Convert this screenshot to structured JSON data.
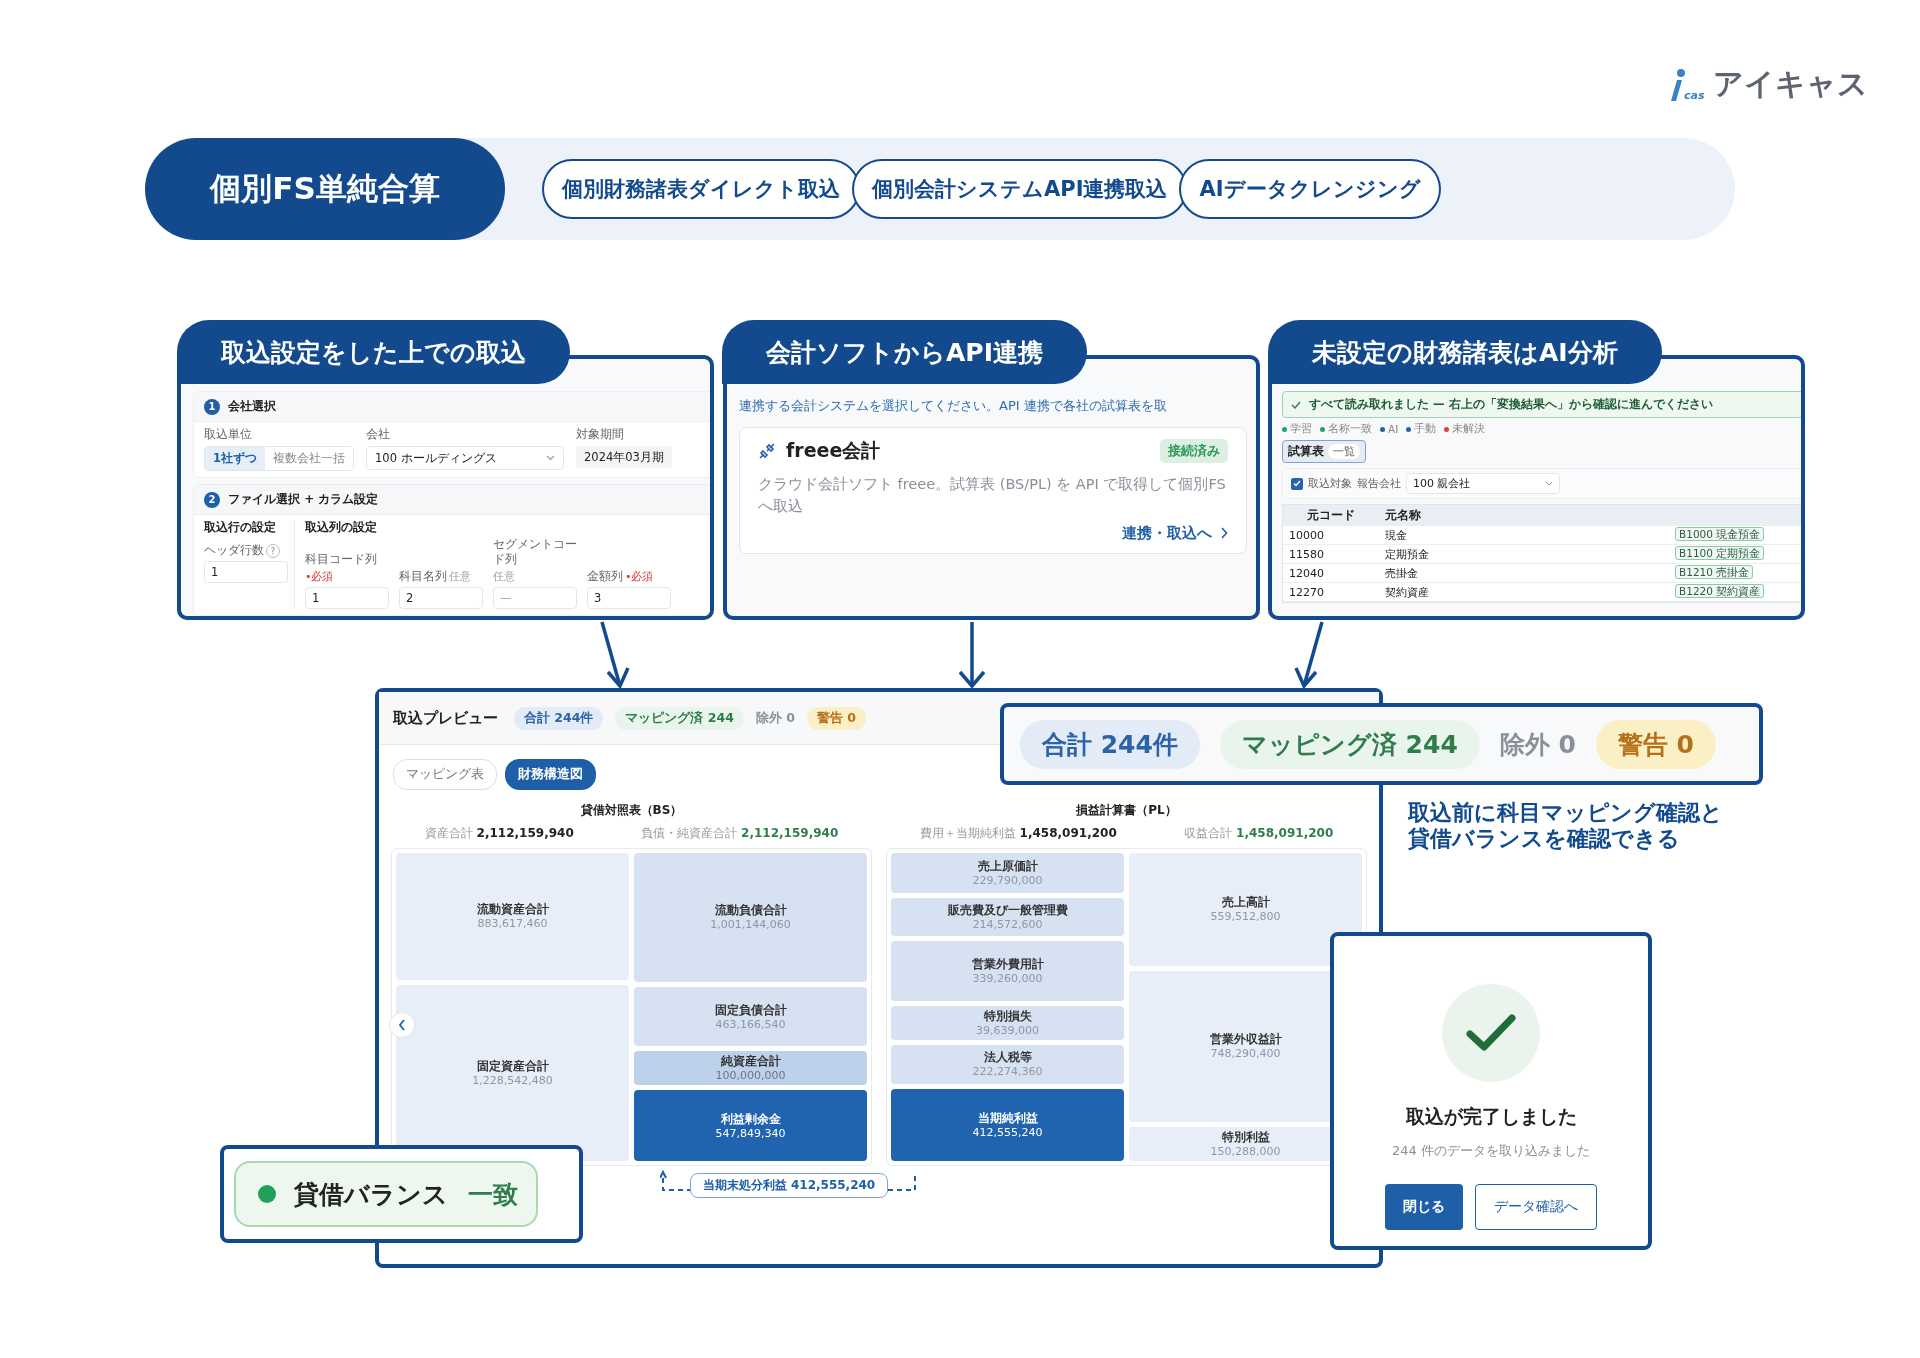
{
  "logo": {
    "mark": "cas",
    "name": "アイキャス"
  },
  "header": {
    "title": "個別FS単純合算",
    "features": [
      "個別財務諸表ダイレクト取込",
      "個別会計システムAPI連携取込",
      "AIデータクレンジング"
    ]
  },
  "import_settings_panel": {
    "title": "取込設定をした上での取込",
    "company_section": {
      "step": "1",
      "title": "会社選択",
      "unit_label": "取込単位",
      "unit_options": [
        {
          "label": "1社ずつ",
          "selected": true
        },
        {
          "label": "複数会社一括",
          "selected": false
        }
      ],
      "company_label": "会社",
      "company_value": "100 ホールディングス",
      "period_label": "対象期間",
      "period_value": "2024年03月期"
    },
    "file_section": {
      "step": "2",
      "title": "ファイル選択 + カラム設定",
      "row_settings_title": "取込行の設定",
      "header_rows_label": "ヘッダ行数",
      "help": "?",
      "header_rows_value": "1",
      "column_settings_title": "取込列の設定",
      "columns": [
        {
          "label": "科目コード列",
          "tag": "•必須",
          "required": true,
          "value": "1"
        },
        {
          "label": "科目名列",
          "tag": "任意",
          "required": false,
          "value": "2"
        },
        {
          "label": "セグメントコード列",
          "tag": "任意",
          "required": false,
          "placeholder": "—"
        },
        {
          "label": "金額列",
          "tag": "•必須",
          "required": true,
          "value": "3"
        }
      ]
    }
  },
  "api_panel": {
    "title": "会計ソフトからAPI連携",
    "description": "連携する会計システムを選択してください。API 連携で各社の試算表を取",
    "card": {
      "name": "freee会計",
      "status": "接続済み",
      "connected": true,
      "description": "クラウド会計ソフト freee。試算表 (BS/PL) を API で取得して個別FSへ取込",
      "action": "連携・取込へ"
    }
  },
  "ai_panel": {
    "title": "未設定の財務諸表はAI分析",
    "banner": "すべて読み取れました — 右上の「変換結果へ」から確認に進んでください",
    "legend": [
      {
        "label": "学習",
        "color": "#22a06b"
      },
      {
        "label": "名称一致",
        "color": "#22a06b"
      },
      {
        "label": "AI",
        "color": "#2563b0"
      },
      {
        "label": "手動",
        "color": "#2563b0"
      },
      {
        "label": "未解決",
        "color": "#e03e3e"
      }
    ],
    "tab": {
      "label": "試算表",
      "chip": "一覧"
    },
    "filter": {
      "checkbox_label": "取込対象",
      "checked": true,
      "company_label": "報告会社",
      "company_value": "100 親会社"
    },
    "table": {
      "columns": [
        "元コード",
        "元名称"
      ],
      "rows": [
        {
          "code": "10000",
          "name": "現金",
          "mapped": "B1000 現金預金"
        },
        {
          "code": "11580",
          "name": "定期預金",
          "mapped": "B1100 定期預金"
        },
        {
          "code": "12040",
          "name": "売掛金",
          "mapped": "B1210 売掛金"
        },
        {
          "code": "12270",
          "name": "契約資産",
          "mapped": "B1220 契約資産"
        }
      ]
    }
  },
  "preview": {
    "title": "取込プレビュー",
    "stats": [
      {
        "kind": "total",
        "label": "合計 244件"
      },
      {
        "kind": "mapped",
        "label": "マッピング済 244"
      },
      {
        "kind": "excluded",
        "label": "除外 0"
      },
      {
        "kind": "warning",
        "label": "警告 0"
      }
    ],
    "tabs": [
      {
        "label": "マッピング表",
        "selected": false
      },
      {
        "label": "財務構造図",
        "selected": true
      }
    ],
    "statements": [
      {
        "title": "貸借対照表（BS）",
        "left_total": {
          "label": "資産合計",
          "value": "2,112,159,940"
        },
        "right_total": {
          "label": "負債・純資産合計",
          "value": "2,112,159,940"
        },
        "left": [
          {
            "name": "流動資産合計",
            "amount": "883,617,460",
            "kind": "light"
          },
          {
            "name": "固定資産合計",
            "amount": "1,228,542,480",
            "kind": "light"
          }
        ],
        "right": [
          {
            "name": "流動負債合計",
            "amount": "1,001,144,060",
            "kind": "medium"
          },
          {
            "name": "固定負債合計",
            "amount": "463,166,540",
            "kind": "medium"
          },
          {
            "name": "純資産合計",
            "amount": "100,000,000",
            "kind": "strong"
          },
          {
            "name": "利益剰余金",
            "amount": "547,849,340",
            "kind": "primary"
          }
        ]
      },
      {
        "title": "損益計算書（PL）",
        "left_total": {
          "label": "費用＋当期純利益",
          "value": "1,458,091,200"
        },
        "right_total": {
          "label": "収益合計",
          "value": "1,458,091,200"
        },
        "left": [
          {
            "name": "売上原価計",
            "amount": "229,790,000",
            "kind": "medium"
          },
          {
            "name": "販売費及び一般管理費",
            "amount": "214,572,600",
            "kind": "medium"
          },
          {
            "name": "営業外費用計",
            "amount": "339,260,000",
            "kind": "medium"
          },
          {
            "name": "特別損失",
            "amount": "39,639,000",
            "kind": "medium"
          },
          {
            "name": "法人税等",
            "amount": "222,274,360",
            "kind": "medium"
          },
          {
            "name": "当期純利益",
            "amount": "412,555,240",
            "kind": "primary"
          }
        ],
        "right": [
          {
            "name": "売上高計",
            "amount": "559,512,800",
            "kind": "light"
          },
          {
            "name": "営業外収益計",
            "amount": "748,290,400",
            "kind": "light"
          },
          {
            "name": "特別利益",
            "amount": "150,288,000",
            "kind": "light"
          }
        ]
      }
    ],
    "footnote": "当期末処分利益 412,555,240"
  },
  "callout": {
    "stats": [
      {
        "kind": "total",
        "label": "合計 244件"
      },
      {
        "kind": "mapped",
        "label": "マッピング済 244"
      },
      {
        "kind": "excluded",
        "label": "除外 0"
      },
      {
        "kind": "warning",
        "label": "警告 0"
      }
    ]
  },
  "caption": "取込前に科目マッピング確認と貸借バランスを確認できる",
  "success": {
    "title": "取込が完了しました",
    "message": "244 件のデータを取り込みました",
    "buttons": [
      {
        "label": "閉じる",
        "kind": "primary"
      },
      {
        "label": "データ確認へ",
        "kind": "secondary"
      }
    ]
  },
  "balance": {
    "label": "貸借バランス",
    "status": "一致",
    "balanced": true
  }
}
